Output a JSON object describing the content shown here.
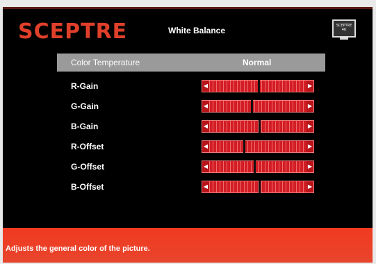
{
  "brand": "SCEPTRE",
  "menu_title": "White Balance",
  "tv_icon": {
    "name": "tv-icon",
    "text": "SCEPTRE 4K"
  },
  "header": {
    "label": "Color Temperature",
    "value": "Normal"
  },
  "rows": [
    {
      "label": "R-Gain",
      "level": 0.5
    },
    {
      "label": "G-Gain",
      "level": 0.43
    },
    {
      "label": "B-Gain",
      "level": 0.51
    },
    {
      "label": "R-Offset",
      "level": 0.35
    },
    {
      "label": "G-Offset",
      "level": 0.46
    },
    {
      "label": "B-Offset",
      "level": 0.51
    }
  ],
  "arrows": {
    "left": "◀",
    "right": "▶"
  },
  "description": "Adjusts the general color of the picture.",
  "colors": {
    "accent": "#e0402a",
    "slider": "#d31d24",
    "footer": "#f03a20"
  }
}
